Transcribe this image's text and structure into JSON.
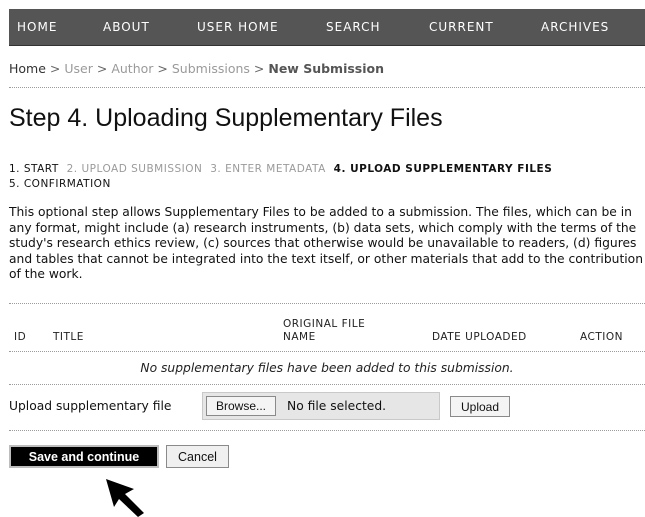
{
  "nav": {
    "items": [
      "HOME",
      "ABOUT",
      "USER HOME",
      "SEARCH",
      "CURRENT",
      "ARCHIVES"
    ]
  },
  "breadcrumb": {
    "items": [
      "Home",
      "User",
      "Author",
      "Submissions"
    ],
    "current": "New Submission",
    "separator": ">"
  },
  "page": {
    "title": "Step 4. Uploading Supplementary Files"
  },
  "steps": [
    {
      "label": "1. START",
      "state": "done"
    },
    {
      "label": "2. UPLOAD SUBMISSION",
      "state": "pending"
    },
    {
      "label": "3. ENTER METADATA",
      "state": "pending"
    },
    {
      "label": "4. UPLOAD SUPPLEMENTARY FILES",
      "state": "active"
    },
    {
      "label": "5. CONFIRMATION",
      "state": "done"
    }
  ],
  "intro": "This optional step allows Supplementary Files to be added to a submission. The files, which can be in any format, might include (a) research instruments, (b) data sets, which comply with the terms of the study's research ethics review, (c) sources that otherwise would be unavailable to readers, (d) figures and tables that cannot be integrated into the text itself, or other materials that add to the contribution of the work.",
  "table": {
    "headers": {
      "id": "ID",
      "title": "TITLE",
      "original_1": "ORIGINAL FILE",
      "original_2": "NAME",
      "date": "DATE UPLOADED",
      "action": "ACTION"
    },
    "empty_message": "No supplementary files have been added to this submission."
  },
  "upload": {
    "label": "Upload supplementary file",
    "browse_label": "Browse...",
    "file_status": "No file selected.",
    "upload_label": "Upload"
  },
  "actions": {
    "save_label": "Save and continue",
    "cancel_label": "Cancel"
  },
  "colors": {
    "nav_bg": "#555555",
    "save_bg": "#000000"
  },
  "icons": {
    "cursor": "mouse-pointer-arrow-icon"
  }
}
